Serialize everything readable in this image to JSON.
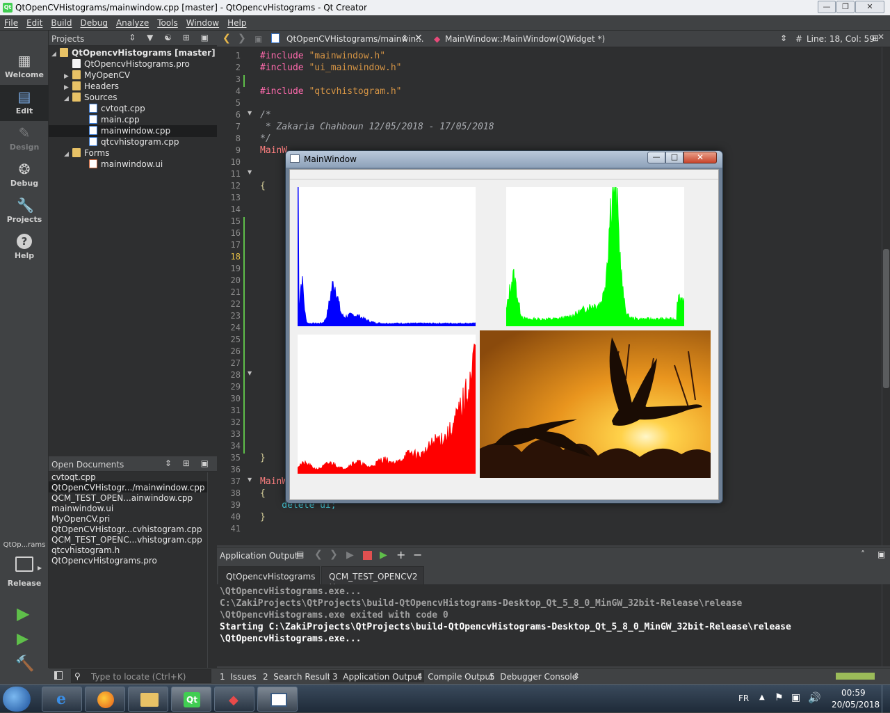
{
  "window": {
    "title": "QtOpenCVHistograms/mainwindow.cpp [master] - QtOpencvHistograms - Qt Creator"
  },
  "menu": [
    "File",
    "Edit",
    "Build",
    "Debug",
    "Analyze",
    "Tools",
    "Window",
    "Help"
  ],
  "modes": [
    {
      "label": "Welcome",
      "icon": "welcome-icon",
      "state": "normal"
    },
    {
      "label": "Edit",
      "icon": "edit-icon",
      "state": "active"
    },
    {
      "label": "Design",
      "icon": "design-icon",
      "state": "disabled"
    },
    {
      "label": "Debug",
      "icon": "debug-icon",
      "state": "normal"
    },
    {
      "label": "Projects",
      "icon": "projects-icon",
      "state": "normal"
    },
    {
      "label": "Help",
      "icon": "help-icon",
      "state": "normal"
    }
  ],
  "projects": {
    "header": "Projects",
    "root": "QtOpencvHistograms [master]",
    "items": [
      {
        "label": "QtOpencvHistograms.pro",
        "kind": "pro"
      },
      {
        "label": "MyOpenCV",
        "kind": "folder"
      },
      {
        "label": "Headers",
        "kind": "folder"
      },
      {
        "label": "Sources",
        "kind": "folder"
      },
      {
        "label": "cvtoqt.cpp",
        "kind": "cpp"
      },
      {
        "label": "main.cpp",
        "kind": "cpp"
      },
      {
        "label": "mainwindow.cpp",
        "kind": "cpp",
        "selected": true
      },
      {
        "label": "qtcvhistogram.cpp",
        "kind": "cpp"
      },
      {
        "label": "Forms",
        "kind": "folder"
      },
      {
        "label": "mainwindow.ui",
        "kind": "ui"
      }
    ]
  },
  "open_documents": {
    "header": "Open Documents",
    "items": [
      "cvtoqt.cpp",
      "QtOpenCVHistogr.../mainwindow.cpp",
      "QCM_TEST_OPEN...ainwindow.cpp",
      "mainwindow.ui",
      "MyOpenCV.pri",
      "QtOpenCVHistogr...cvhistogram.cpp",
      "QCM_TEST_OPENC...vhistogram.cpp",
      "qtcvhistogram.h",
      "QtOpencvHistograms.pro"
    ],
    "selected_index": 1
  },
  "editor": {
    "file_combo": "QtOpenCVHistograms/mainwin...",
    "symbol_combo": "MainWindow::MainWindow(QWidget *)",
    "position": "Line: 18, Col: 59",
    "hash": "#",
    "line_numbers": [
      "1",
      "2",
      "3",
      "4",
      "5",
      "6",
      "7",
      "8",
      "9",
      "10",
      "11",
      "12",
      "13",
      "14",
      "15",
      "16",
      "17",
      "18",
      "19",
      "20",
      "21",
      "22",
      "23",
      "24",
      "25",
      "26",
      "27",
      "28",
      "29",
      "30",
      "31",
      "32",
      "33",
      "34",
      "35",
      "36",
      "37",
      "38",
      "39",
      "40",
      "41"
    ],
    "current_line": "18",
    "code": {
      "l1_pp": "#include",
      "l1_str": "\"mainwindow.h\"",
      "l2_pp": "#include",
      "l2_str": "\"ui_mainwindow.h\"",
      "l4_pp": "#include",
      "l4_str": "\"qtcvhistogram.h\"",
      "l6": "/*",
      "l7": " * Zakaria Chahboun 12/05/2018 - 17/05/2018",
      "l8": "*/",
      "l9": "MainW",
      "l12": "{",
      "l35": "}",
      "l37": "MainW",
      "l38": "{",
      "l39": "    delete ui;",
      "l40": "}"
    }
  },
  "floating_window": {
    "title": "MainWindow",
    "image_alt": "geese silhouettes at sunset"
  },
  "output": {
    "header": "Application Output",
    "tabs": [
      "QtOpencvHistograms",
      "QCM_TEST_OPENCV2"
    ],
    "lines": [
      {
        "text": "\\QtOpencvHistograms.exe...",
        "style": "grey"
      },
      {
        "text": "C:\\ZakiProjects\\QtProjects\\build-QtOpencvHistograms-Desktop_Qt_5_8_0_MinGW_32bit-Release\\release",
        "style": "grey"
      },
      {
        "text": "\\QtOpencvHistograms.exe exited with code 0",
        "style": "grey"
      },
      {
        "text": "",
        "style": "grey"
      },
      {
        "text": "Starting C:\\ZakiProjects\\QtProjects\\build-QtOpencvHistograms-Desktop_Qt_5_8_0_MinGW_32bit-Release\\release",
        "style": "white"
      },
      {
        "text": "\\QtOpencvHistograms.exe...",
        "style": "white"
      }
    ]
  },
  "kit": {
    "project": "QtOp...rams",
    "config": "Release"
  },
  "statusbar": {
    "locate_placeholder": "Type to locate (Ctrl+K)",
    "panes": [
      {
        "num": "1",
        "label": "Issues"
      },
      {
        "num": "2",
        "label": "Search Results"
      },
      {
        "num": "3",
        "label": "Application Output"
      },
      {
        "num": "4",
        "label": "Compile Output"
      },
      {
        "num": "5",
        "label": "Debugger Console"
      }
    ],
    "progress": 1.0
  },
  "taskbar": {
    "lang": "FR",
    "time": "00:59",
    "date": "20/05/2018"
  },
  "colors": {
    "blue_hist": "#0000ff",
    "green_hist": "#00ff00",
    "red_hist": "#ff0000",
    "progress": "#9bbb59"
  }
}
